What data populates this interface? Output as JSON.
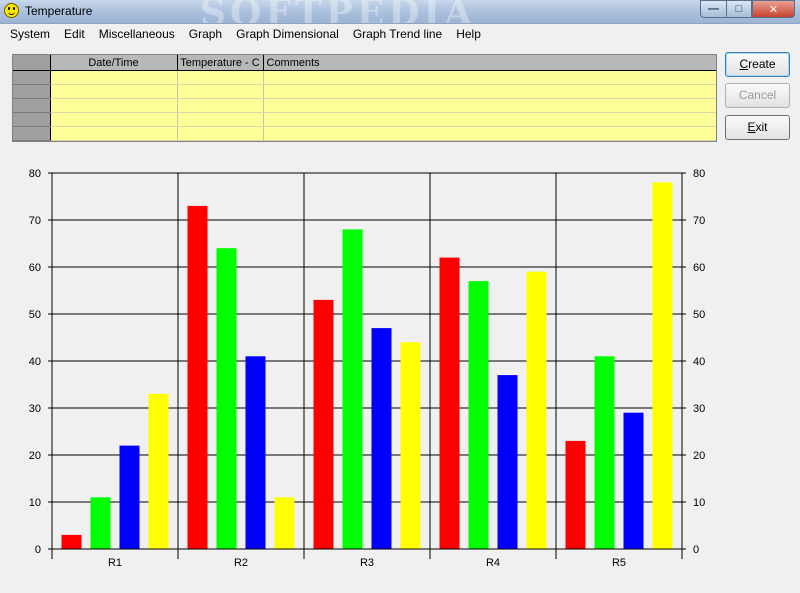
{
  "window": {
    "title": "Temperature",
    "watermark": "SOFTPEDIA"
  },
  "menu": [
    "System",
    "Edit",
    "Miscellaneous",
    "Graph",
    "Graph Dimensional",
    "Graph Trend line",
    "Help"
  ],
  "grid": {
    "columns": [
      "Date/Time",
      "Temperature - C",
      "Comments"
    ],
    "rows": 5
  },
  "buttons": {
    "create_first": "C",
    "create_rest": "reate",
    "cancel": "Cancel",
    "exit_first": "E",
    "exit_rest": "xit"
  },
  "chart_data": {
    "type": "bar",
    "categories": [
      "R1",
      "R2",
      "R3",
      "R4",
      "R5"
    ],
    "series": [
      {
        "color": "#ff0000",
        "values": [
          3,
          73,
          53,
          62,
          23
        ]
      },
      {
        "color": "#00ff00",
        "values": [
          11,
          64,
          68,
          57,
          41
        ]
      },
      {
        "color": "#0000ff",
        "values": [
          22,
          41,
          47,
          37,
          29
        ]
      },
      {
        "color": "#ffff00",
        "values": [
          33,
          11,
          44,
          59,
          78
        ]
      }
    ],
    "ylim": [
      0,
      80
    ],
    "yticks": [
      0,
      10,
      20,
      30,
      40,
      50,
      60,
      70,
      80
    ],
    "grid": true,
    "right_axis": true
  }
}
